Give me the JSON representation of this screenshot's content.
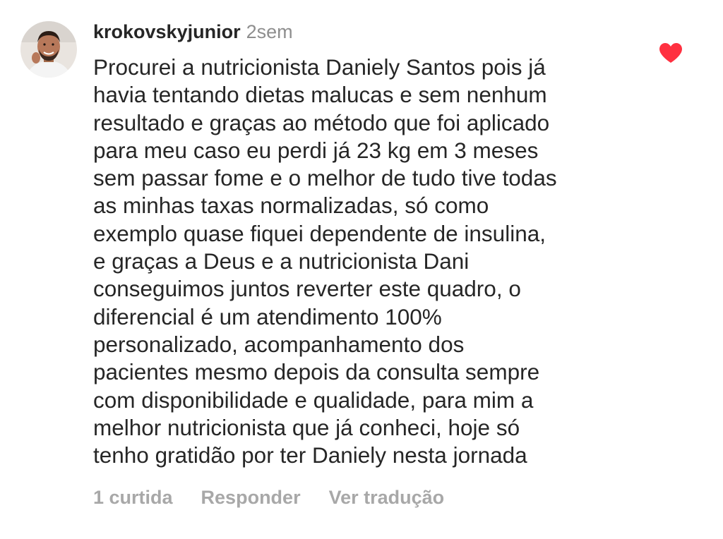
{
  "comment": {
    "username": "krokovskyjunior",
    "time": "2sem",
    "lines": [
      "Procurei a nutricionista Daniely Santos pois já",
      "havia tentando dietas malucas e sem nenhum",
      "resultado e graças ao método que foi aplicado",
      "para meu caso eu perdi já 23 kg em 3 meses",
      "sem passar fome e o melhor de tudo tive todas",
      "as minhas taxas normalizadas, só como",
      "exemplo quase fiquei dependente de insulina,",
      "e graças a Deus e a nutricionista Dani",
      "conseguimos juntos reverter este quadro, o",
      "diferencial é um atendimento 100%",
      "personalizado, acompanhamento dos",
      "pacientes mesmo depois da consulta sempre",
      "com disponibilidade e qualidade, para mim a",
      "melhor nutricionista que já conheci, hoje só",
      "tenho gratidão por ter Daniely nesta jornada"
    ],
    "likes_label": "1 curtida",
    "reply_label": "Responder",
    "translate_label": "Ver tradução",
    "liked": true,
    "like_color": "#ff3040",
    "like_icon": "heart-icon"
  }
}
